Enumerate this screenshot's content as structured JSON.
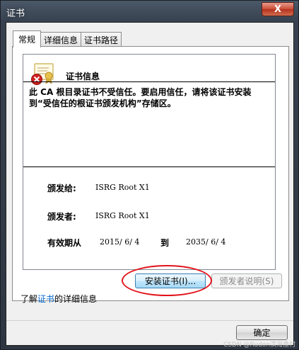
{
  "window": {
    "title": "证书",
    "close_label": "X"
  },
  "tabs": [
    {
      "label": "常规",
      "active": true
    },
    {
      "label": "详细信息",
      "active": false
    },
    {
      "label": "证书路径",
      "active": false
    }
  ],
  "info": {
    "title": "证书信息",
    "warning": "此 CA 根目录证书不受信任。要启用信任，请将该证书安装到“受信任的根证书颁发机构”存储区。",
    "issued_to_label": "颁发给:",
    "issued_to_value": "ISRG Root X1",
    "issued_by_label": "颁发者:",
    "issued_by_value": "ISRG Root X1",
    "validity_label": "有效期从",
    "valid_from": "2015/ 6/ 4",
    "to_label": "到",
    "valid_to": "2035/ 6/ 4"
  },
  "buttons": {
    "install_label": "安装证书(I)...",
    "issuer_statement_label": "颁发者说明(S)",
    "ok_label": "确定"
  },
  "learn_more": {
    "prefix": "了解",
    "link": "证书",
    "suffix": "的详细信息"
  },
  "watermark": "CSDN @Rudon滨海渔村",
  "colors": {
    "highlight_ring": "#e3121a",
    "link": "#0066cc"
  }
}
